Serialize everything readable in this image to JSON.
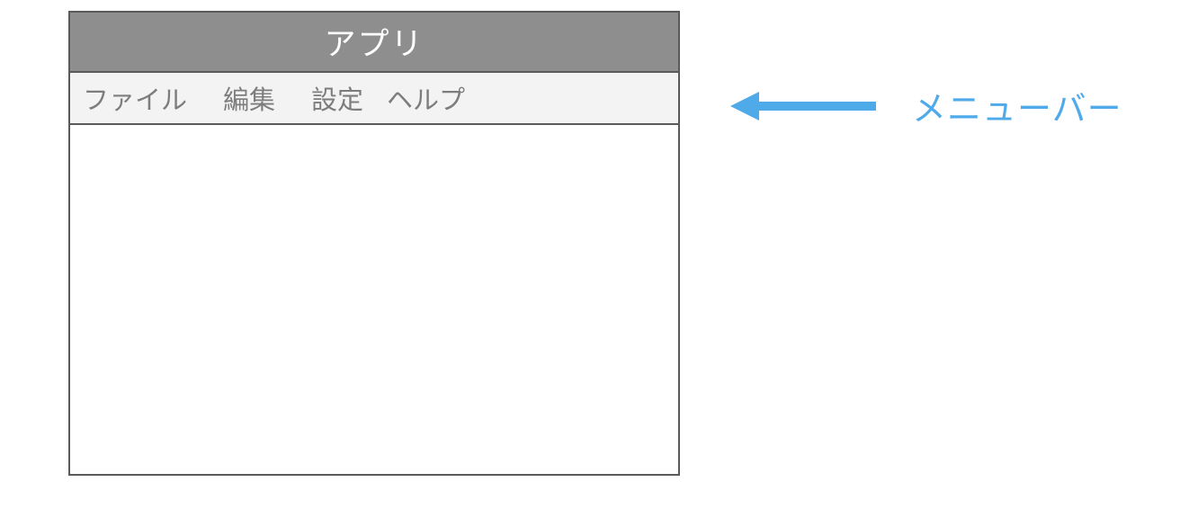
{
  "window": {
    "title": "アプリ"
  },
  "menubar": {
    "items": [
      {
        "label": "ファイル"
      },
      {
        "label": "編集"
      },
      {
        "label": "設定"
      },
      {
        "label": "ヘルプ"
      }
    ]
  },
  "annotation": {
    "label": "メニューバー",
    "color": "#4faaea"
  }
}
